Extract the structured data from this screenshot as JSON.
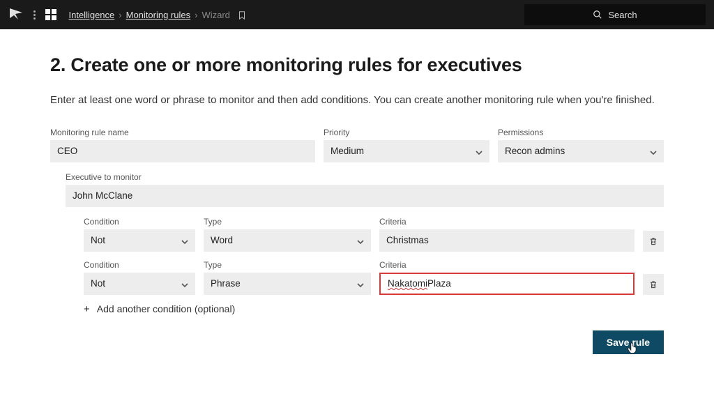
{
  "topbar": {
    "breadcrumb": {
      "item1": "Intelligence",
      "item2": "Monitoring rules",
      "current": "Wizard"
    },
    "search_placeholder": "Search"
  },
  "page": {
    "title": "2. Create one or more monitoring rules for executives",
    "intro": "Enter at least one word or phrase to monitor and then add conditions. You can create another monitoring rule when you're finished."
  },
  "labels": {
    "rule_name": "Monitoring rule name",
    "priority": "Priority",
    "permissions": "Permissions",
    "executive": "Executive to monitor",
    "condition": "Condition",
    "type": "Type",
    "criteria": "Criteria",
    "add_condition": "Add another condition (optional)"
  },
  "values": {
    "rule_name": "CEO",
    "priority": "Medium",
    "permissions": "Recon admins",
    "executive": "John McClane"
  },
  "conditions": [
    {
      "condition": "Not",
      "type": "Word",
      "criteria": "Christmas"
    },
    {
      "condition": "Not",
      "type": "Phrase",
      "criteria_part1": "Nakatomi",
      "criteria_part2": " Plaza"
    }
  ],
  "buttons": {
    "save": "Save rule"
  }
}
